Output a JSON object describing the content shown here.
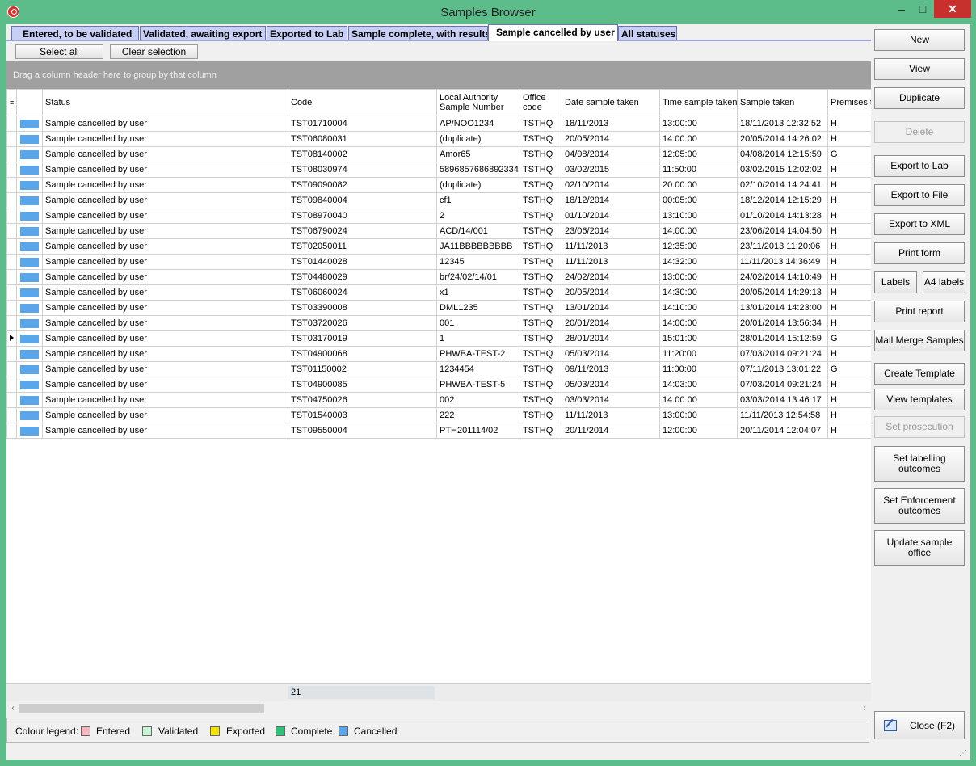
{
  "window": {
    "title": "Samples Browser",
    "minimize": "–",
    "maximize": "□",
    "close": "✕"
  },
  "tabs": [
    "Entered, to be validated",
    "Validated, awaiting export",
    "Exported to Lab",
    "Sample complete, with results",
    "Sample cancelled by user",
    "All statuses"
  ],
  "active_tab": 4,
  "toolbar": {
    "select_all": "Select all",
    "clear_selection": "Clear selection"
  },
  "group_hint": "Drag a column header here to group by that column",
  "columns": [
    "Status",
    "Code",
    "Local Authority Sample Number",
    "Office code",
    "Date sample taken",
    "Time sample taken",
    "Sample taken",
    "Premises type"
  ],
  "rows": [
    [
      "Sample cancelled by user",
      "TST01710004",
      "AP/NOO1234",
      "TSTHQ",
      "18/11/2013",
      "13:00:00",
      "18/11/2013 12:32:52",
      "H"
    ],
    [
      "Sample cancelled by user",
      "TST06080031",
      "(duplicate)",
      "TSTHQ",
      "20/05/2014",
      "14:00:00",
      "20/05/2014 14:26:02",
      "H"
    ],
    [
      "Sample cancelled by user",
      "TST08140002",
      "Amor65",
      "TSTHQ",
      "04/08/2014",
      "12:05:00",
      "04/08/2014 12:15:59",
      "G"
    ],
    [
      "Sample cancelled by user",
      "TST08030974",
      "5896857686892334",
      "TSTHQ",
      "03/02/2015",
      "11:50:00",
      "03/02/2015 12:02:02",
      "H"
    ],
    [
      "Sample cancelled by user",
      "TST09090082",
      "(duplicate)",
      "TSTHQ",
      "02/10/2014",
      "20:00:00",
      "02/10/2014 14:24:41",
      "H"
    ],
    [
      "Sample cancelled by user",
      "TST09840004",
      "cf1",
      "TSTHQ",
      "18/12/2014",
      "00:05:00",
      "18/12/2014 12:15:29",
      "H"
    ],
    [
      "Sample cancelled by user",
      "TST08970040",
      "2",
      "TSTHQ",
      "01/10/2014",
      "13:10:00",
      "01/10/2014 14:13:28",
      "H"
    ],
    [
      "Sample cancelled by user",
      "TST06790024",
      "ACD/14/001",
      "TSTHQ",
      "23/06/2014",
      "14:00:00",
      "23/06/2014 14:04:50",
      "H"
    ],
    [
      "Sample cancelled by user",
      "TST02050011",
      "JA11BBBBBBBBB",
      "TSTHQ",
      "11/11/2013",
      "12:35:00",
      "23/11/2013 11:20:06",
      "H"
    ],
    [
      "Sample cancelled by user",
      "TST01440028",
      "12345",
      "TSTHQ",
      "11/11/2013",
      "14:32:00",
      "11/11/2013 14:36:49",
      "H"
    ],
    [
      "Sample cancelled by user",
      "TST04480029",
      "br/24/02/14/01",
      "TSTHQ",
      "24/02/2014",
      "13:00:00",
      "24/02/2014 14:10:49",
      "H"
    ],
    [
      "Sample cancelled by user",
      "TST06060024",
      "x1",
      "TSTHQ",
      "20/05/2014",
      "14:30:00",
      "20/05/2014 14:29:13",
      "H"
    ],
    [
      "Sample cancelled by user",
      "TST03390008",
      "DML1235",
      "TSTHQ",
      "13/01/2014",
      "14:10:00",
      "13/01/2014 14:23:00",
      "H"
    ],
    [
      "Sample cancelled by user",
      "TST03720026",
      "001",
      "TSTHQ",
      "20/01/2014",
      "14:00:00",
      "20/01/2014 13:56:34",
      "H"
    ],
    [
      "Sample cancelled by user",
      "TST03170019",
      "1",
      "TSTHQ",
      "28/01/2014",
      "15:01:00",
      "28/01/2014 15:12:59",
      "G"
    ],
    [
      "Sample cancelled by user",
      "TST04900068",
      "PHWBA-TEST-2",
      "TSTHQ",
      "05/03/2014",
      "11:20:00",
      "07/03/2014 09:21:24",
      "H"
    ],
    [
      "Sample cancelled by user",
      "TST01150002",
      "1234454",
      "TSTHQ",
      "09/11/2013",
      "11:00:00",
      "07/11/2013 13:01:22",
      "G"
    ],
    [
      "Sample cancelled by user",
      "TST04900085",
      "PHWBA-TEST-5",
      "TSTHQ",
      "05/03/2014",
      "14:03:00",
      "07/03/2014 09:21:24",
      "H"
    ],
    [
      "Sample cancelled by user",
      "TST04750026",
      "002",
      "TSTHQ",
      "03/03/2014",
      "14:00:00",
      "03/03/2014 13:46:17",
      "H"
    ],
    [
      "Sample cancelled by user",
      "TST01540003",
      "222",
      "TSTHQ",
      "11/11/2013",
      "13:00:00",
      "11/11/2013 12:54:58",
      "H"
    ],
    [
      "Sample cancelled by user",
      "TST09550004",
      "PTH201114/02",
      "TSTHQ",
      "20/11/2014",
      "12:00:00",
      "20/11/2014 12:04:07",
      "H"
    ]
  ],
  "current_row": 14,
  "row_count": "21",
  "legend": {
    "label": "Colour legend:",
    "items": [
      {
        "name": "Entered",
        "color": "#f7b6c2"
      },
      {
        "name": "Validated",
        "color": "#c8f5d4"
      },
      {
        "name": "Exported",
        "color": "#f2e400"
      },
      {
        "name": "Complete",
        "color": "#2fc07a"
      },
      {
        "name": "Cancelled",
        "color": "#5aa6ea"
      }
    ]
  },
  "side_buttons": {
    "new": "New",
    "view": "View",
    "duplicate": "Duplicate",
    "delete": "Delete",
    "export_lab": "Export to Lab",
    "export_file": "Export to File",
    "export_xml": "Export to XML",
    "print_form": "Print form",
    "labels": "Labels",
    "a4_labels": "A4 labels",
    "print_report": "Print report",
    "mail_merge": "Mail Merge Samples",
    "create_template": "Create Template",
    "view_templates": "View templates",
    "set_prosecution": "Set prosecution",
    "set_labelling": "Set labelling outcomes",
    "set_enforcement": "Set Enforcement outcomes",
    "update_office": "Update sample office",
    "close": "Close (F2)"
  }
}
